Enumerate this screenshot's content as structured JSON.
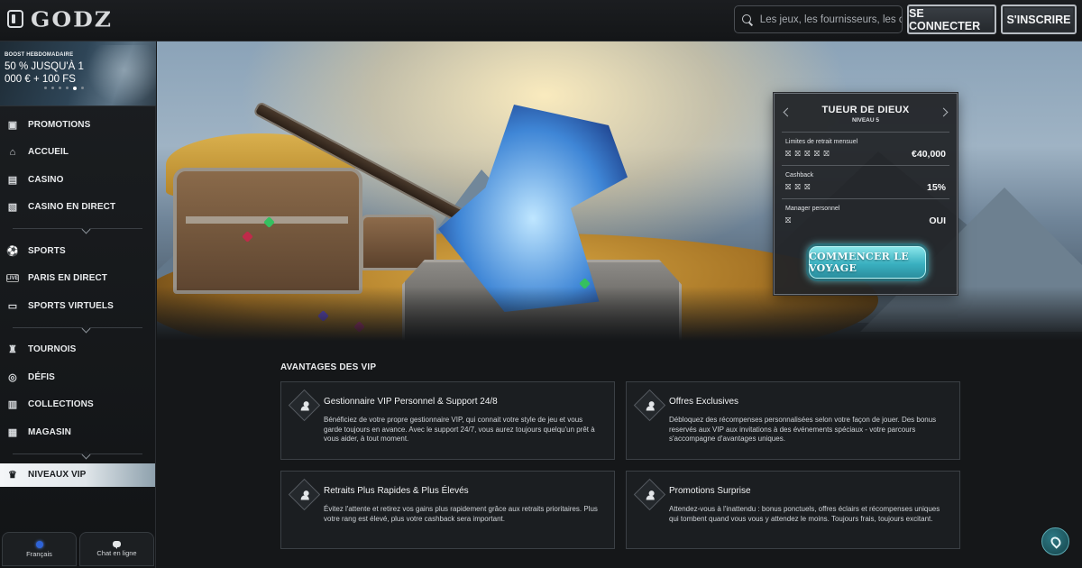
{
  "header": {
    "logo_text": "GODZ",
    "search_placeholder": "Les jeux, les fournisseurs, les caté...",
    "login_label": "SE CONNECTER",
    "signup_label": "S'INSCRIRE"
  },
  "promo_banner": {
    "tag": "BOOST HEBDOMADAIRE",
    "title": "50 % JUSQU'À 1 000 € + 100 FS",
    "slides": 6,
    "active_slide": 5
  },
  "sidebar": {
    "group1": [
      {
        "label": "PROMOTIONS",
        "icon": "gift-icon"
      },
      {
        "label": "ACCUEIL",
        "icon": "temple-icon"
      },
      {
        "label": "CASINO",
        "icon": "slot-machine-icon"
      },
      {
        "label": "CASINO EN DIRECT",
        "icon": "live-cards-icon"
      }
    ],
    "group2": [
      {
        "label": "SPORTS",
        "icon": "football-icon"
      },
      {
        "label": "PARIS EN DIRECT",
        "icon": "live-badge-icon"
      },
      {
        "label": "SPORTS VIRTUELS",
        "icon": "virtual-sports-icon"
      }
    ],
    "group3": [
      {
        "label": "TOURNOIS",
        "icon": "trophy-icon"
      },
      {
        "label": "DÉFIS",
        "icon": "target-icon"
      },
      {
        "label": "COLLECTIONS",
        "icon": "cards-icon"
      },
      {
        "label": "MAGASIN",
        "icon": "store-icon"
      }
    ],
    "active_item": {
      "label": "NIVEAUX VIP",
      "icon": "vip-crown-icon"
    },
    "language_label": "Français",
    "chat_label": "Chat en ligne"
  },
  "vip_card": {
    "title": "TUEUR DE DIEUX",
    "level": "NIVEAU 5",
    "rows": [
      {
        "label": "Limites de retrait mensuel",
        "marks": "⛝ ⛝ ⛝ ⛝ ⛝",
        "value": "€40,000"
      },
      {
        "label": "Cashback",
        "marks": "⛝ ⛝ ⛝",
        "value": "15%"
      },
      {
        "label": "Manager personnel",
        "marks": "⛝",
        "value": "OUI"
      }
    ],
    "cta_label": "COMMENCER LE VOYAGE"
  },
  "benefits": {
    "section_title": "AVANTAGES DES VIP",
    "items": [
      {
        "title": "Gestionnaire VIP Personnel & Support 24/8",
        "text": "Bénéficiez de votre propre gestionnaire VIP, qui connait votre style de jeu et vous garde toujours en avance. Avec le support 24/7, vous aurez toujours quelqu'un prêt à vous aider, à tout moment."
      },
      {
        "title": "Offres Exclusives",
        "text": "Débloquez des récompenses personnalisées selon votre façon de jouer. Des bonus reservés aux VIP aux invitations à des événements spéciaux - votre parcours s'accompagne d'avantages uniques."
      },
      {
        "title": "Retraits Plus Rapides & Plus Élevés",
        "text": "Évitez l'attente et retirez vos gains plus rapidement grâce aux retraits prioritaires. Plus votre rang est élevé, plus votre cashback sera important."
      },
      {
        "title": "Promotions Surprise",
        "text": "Attendez-vous à l'inattendu : bonus ponctuels, offres éclairs et récompenses uniques qui tombent quand vous vous y attendez le moins. Toujours frais, toujours excitant."
      }
    ]
  },
  "colors": {
    "accent_cta": "#3ab0c0",
    "background": "#151719",
    "card_border": "#3b4045"
  }
}
